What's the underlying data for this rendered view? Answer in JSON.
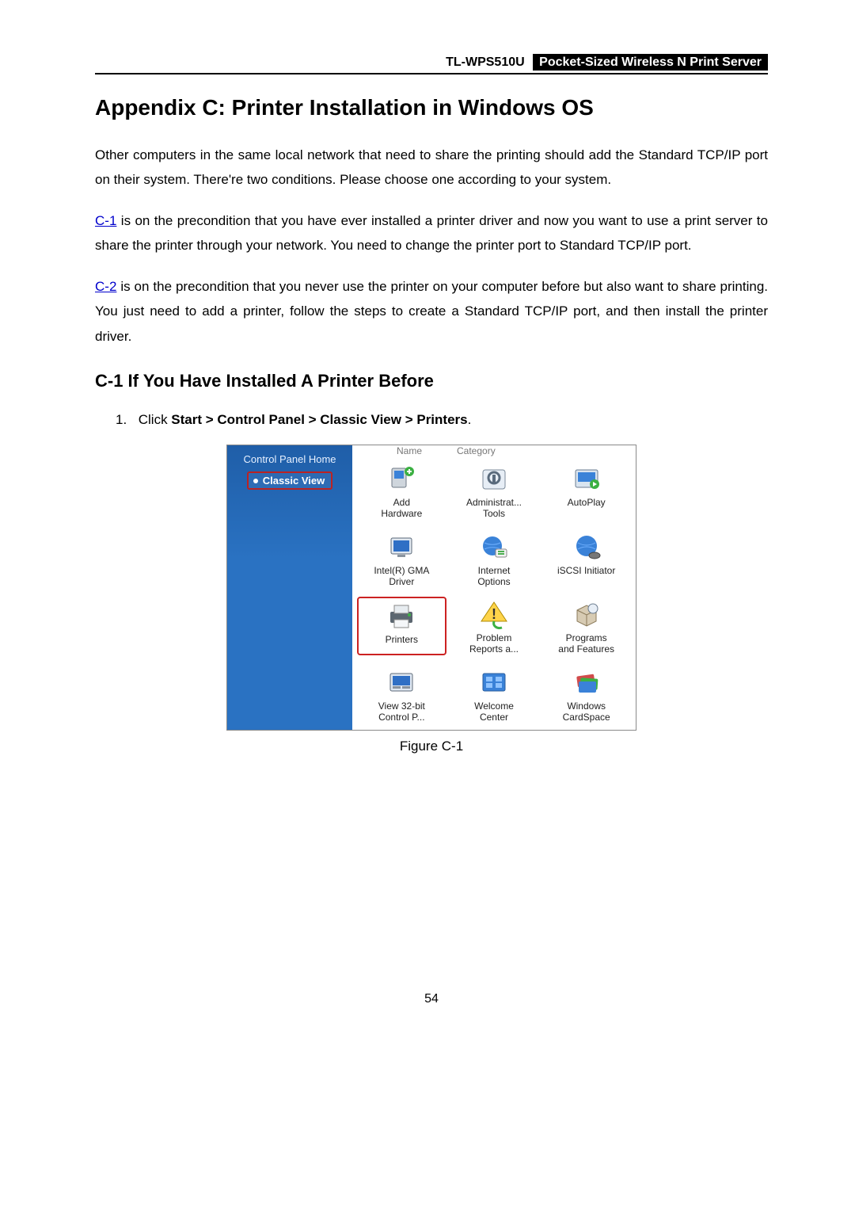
{
  "header": {
    "model": "TL-WPS510U",
    "desc": "Pocket-Sized Wireless N Print Server"
  },
  "title": "Appendix C: Printer Installation in Windows OS",
  "para1": "Other computers in the same local network that need to share the printing should add the Standard TCP/IP port on their system. There're two conditions. Please choose one according to your system.",
  "para2_link": "C-1",
  "para2_rest": " is on the precondition that you have ever installed a printer driver and now you want to use a print server to share the printer through your network. You need to change the printer port to Standard TCP/IP port.",
  "para3_link": "C-2",
  "para3_rest": " is on the precondition that you never use the printer on your computer before but also want to share printing. You just need to add a printer, follow the steps to create a Standard TCP/IP port, and then install the printer driver.",
  "section_title": "C-1 If You Have Installed A Printer Before",
  "step1_num": "1.",
  "step1_pre": "Click ",
  "step1_bold": "Start > Control Panel > Classic View > Printers",
  "step1_post": ".",
  "figure_caption": "Figure C-1",
  "page_number": "54",
  "cp": {
    "home": "Control Panel Home",
    "classic": "Classic View",
    "col_name": "Name",
    "col_category": "Category",
    "items": [
      {
        "label1": "Add",
        "label2": "Hardware"
      },
      {
        "label1": "Administrat...",
        "label2": "Tools"
      },
      {
        "label1": "AutoPlay",
        "label2": ""
      },
      {
        "label1": "Intel(R) GMA",
        "label2": "Driver"
      },
      {
        "label1": "Internet",
        "label2": "Options"
      },
      {
        "label1": "iSCSI Initiator",
        "label2": ""
      },
      {
        "label1": "Printers",
        "label2": ""
      },
      {
        "label1": "Problem",
        "label2": "Reports a..."
      },
      {
        "label1": "Programs",
        "label2": "and Features"
      },
      {
        "label1": "View 32-bit",
        "label2": "Control P..."
      },
      {
        "label1": "Welcome",
        "label2": "Center"
      },
      {
        "label1": "Windows",
        "label2": "CardSpace"
      }
    ]
  }
}
